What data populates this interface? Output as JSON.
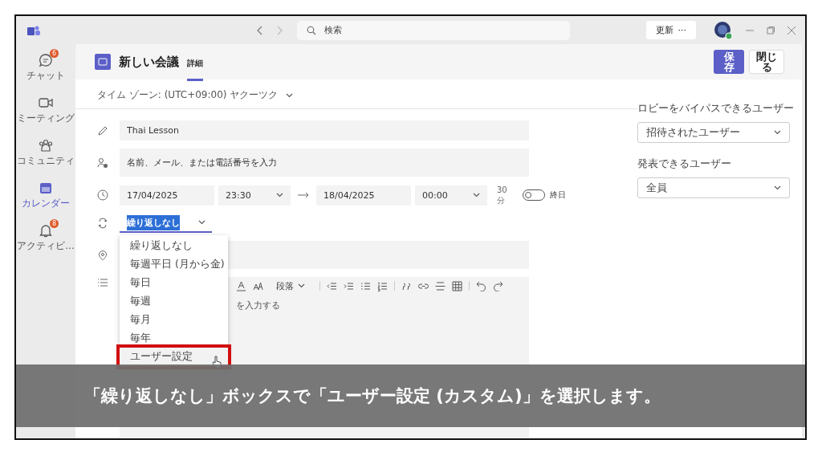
{
  "window": {
    "search": {
      "placeholder": "検索"
    },
    "update_button": "更新",
    "more_button": "···"
  },
  "rail": [
    {
      "kind": "chat",
      "label": "チャット",
      "badge": "6",
      "selected": false
    },
    {
      "kind": "meeting",
      "label": "ミーティング",
      "selected": false
    },
    {
      "kind": "community",
      "label": "コミュニティ",
      "selected": false
    },
    {
      "kind": "calendar",
      "label": "カレンダー",
      "selected": true
    },
    {
      "kind": "activity",
      "label": "アクティビ…",
      "badge": "8",
      "selected": false
    }
  ],
  "header": {
    "title": "新しい会議",
    "tabs": [
      {
        "label": "詳細",
        "selected": true
      }
    ],
    "save_button": "保存",
    "close_button": "閉じる"
  },
  "timezone": "タイム ゾーン: (UTC+09:00) ヤクーツク",
  "form": {
    "title": "Thai Lesson",
    "attendees_placeholder": "名前、メール、または電話番号を入力",
    "start_date": "17/04/2025",
    "start_time": "23:30",
    "end_date": "18/04/2025",
    "end_time": "00:00",
    "duration": "30 分",
    "all_day": {
      "label": "終日",
      "on": false
    },
    "repeat": {
      "value": "繰り返しなし",
      "expanded": true,
      "options": [
        {
          "label": "繰り返しなし",
          "highlighted": false
        },
        {
          "label": "毎週平日 (月から金)",
          "highlighted": false
        },
        {
          "label": "毎日",
          "highlighted": false
        },
        {
          "label": "毎週",
          "highlighted": false
        },
        {
          "label": "毎月",
          "highlighted": false
        },
        {
          "label": "毎年",
          "highlighted": false
        },
        {
          "label": "ユーザー設定",
          "highlighted": true
        }
      ]
    }
  },
  "editor": {
    "paragraph_style": "段落",
    "placeholder": "を入力する"
  },
  "side": {
    "lobby_label": "ロビーをバイパスできるユーザー",
    "lobby_value": "招待されたユーザー",
    "presenters_label": "発表できるユーザー",
    "presenters_value": "全員"
  },
  "caption": "「繰り返しなし」ボックスで「ユーザー設定 (カスタム)」を選択します。"
}
